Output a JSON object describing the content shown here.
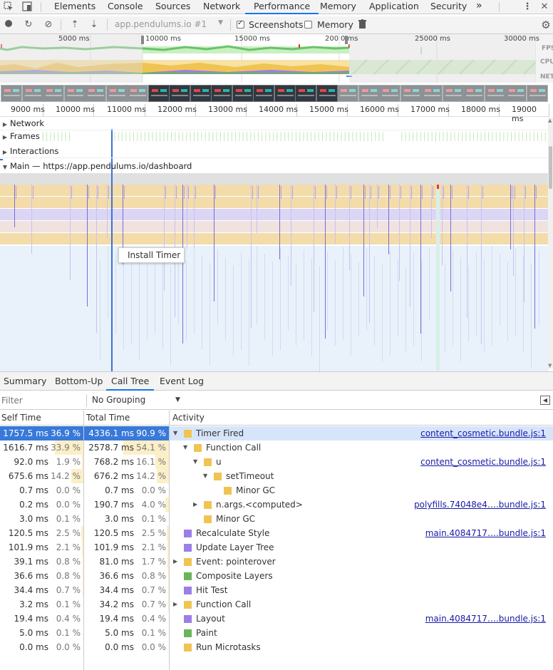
{
  "tabs": [
    "Elements",
    "Console",
    "Sources",
    "Network",
    "Performance",
    "Memory",
    "Application",
    "Security"
  ],
  "more_tabs_glyph": "»",
  "icons": {
    "inspect": "inspect-icon",
    "device": "device-toggle-icon",
    "menu": "kebab-menu-icon",
    "close": "close-icon"
  },
  "toolbar": {
    "recording_target": "app.pendulums.io #1",
    "screenshots_label": "Screenshots",
    "screenshots_checked": true,
    "memory_label": "Memory",
    "memory_checked": false
  },
  "overview": {
    "ticks": [
      "5000 ms",
      "10000 ms",
      "15000 ms",
      "200",
      "0 ms",
      "25000 ms",
      "30000 ms"
    ],
    "lane_labels": [
      "FPS",
      "CPU",
      "NET"
    ]
  },
  "ruler_ticks": [
    "9000 ms",
    "10000 ms",
    "11000 ms",
    "12000 ms",
    "13000 ms",
    "14000 ms",
    "15000 ms",
    "16000 ms",
    "17000 ms",
    "18000 ms",
    "19000 ms"
  ],
  "tracks": {
    "network": "Network",
    "frames": "Frames",
    "interactions": "Interactions",
    "main": "Main — https://app.pendulums.io/dashboard"
  },
  "tooltip": "Install Timer",
  "bottom_tabs": [
    "Summary",
    "Bottom-Up",
    "Call Tree",
    "Event Log"
  ],
  "active_bottom_tab": "Call Tree",
  "filter_placeholder": "Filter",
  "grouping": "No Grouping",
  "columns": {
    "self": "Self Time",
    "total": "Total Time",
    "activity": "Activity"
  },
  "colors": {
    "scripting": "#f0c452",
    "rendering": "#9b7fe6",
    "painting": "#6ab55a",
    "selection": "#3879d9",
    "accent": "#1a73e8"
  },
  "rows": [
    {
      "self": "1757.5 ms",
      "self_pct": "36.9 %",
      "total": "4336.1 ms",
      "total_pct": "90.9 %",
      "name": "Timer Fired",
      "cat": "scripting",
      "indent": 0,
      "expander": "open",
      "link": "content_cosmetic.bundle.js:1",
      "selected": true
    },
    {
      "self": "1616.7 ms",
      "self_pct": "33.9 %",
      "total": "2578.7 ms",
      "total_pct": "54.1 %",
      "name": "Function Call",
      "cat": "scripting",
      "indent": 1,
      "expander": "open",
      "link": ""
    },
    {
      "self": "92.0 ms",
      "self_pct": "1.9 %",
      "total": "768.2 ms",
      "total_pct": "16.1 %",
      "name": "u",
      "cat": "scripting",
      "indent": 2,
      "expander": "open",
      "link": "content_cosmetic.bundle.js:1"
    },
    {
      "self": "675.6 ms",
      "self_pct": "14.2 %",
      "total": "676.2 ms",
      "total_pct": "14.2 %",
      "name": "setTimeout",
      "cat": "scripting",
      "indent": 3,
      "expander": "open",
      "link": ""
    },
    {
      "self": "0.7 ms",
      "self_pct": "0.0 %",
      "total": "0.7 ms",
      "total_pct": "0.0 %",
      "name": "Minor GC",
      "cat": "scripting",
      "indent": 4,
      "expander": "",
      "link": ""
    },
    {
      "self": "0.2 ms",
      "self_pct": "0.0 %",
      "total": "190.7 ms",
      "total_pct": "4.0 %",
      "name": "n.args.<computed>",
      "cat": "scripting",
      "indent": 2,
      "expander": "closed",
      "link": "polyfills.74048e4….bundle.js:1"
    },
    {
      "self": "3.0 ms",
      "self_pct": "0.1 %",
      "total": "3.0 ms",
      "total_pct": "0.1 %",
      "name": "Minor GC",
      "cat": "scripting",
      "indent": 2,
      "expander": "",
      "link": ""
    },
    {
      "self": "120.5 ms",
      "self_pct": "2.5 %",
      "total": "120.5 ms",
      "total_pct": "2.5 %",
      "name": "Recalculate Style",
      "cat": "rendering",
      "indent": 0,
      "expander": "",
      "link": "main.4084717….bundle.js:1"
    },
    {
      "self": "101.9 ms",
      "self_pct": "2.1 %",
      "total": "101.9 ms",
      "total_pct": "2.1 %",
      "name": "Update Layer Tree",
      "cat": "rendering",
      "indent": 0,
      "expander": "",
      "link": ""
    },
    {
      "self": "39.1 ms",
      "self_pct": "0.8 %",
      "total": "81.0 ms",
      "total_pct": "1.7 %",
      "name": "Event: pointerover",
      "cat": "scripting",
      "indent": 0,
      "expander": "closed",
      "link": ""
    },
    {
      "self": "36.6 ms",
      "self_pct": "0.8 %",
      "total": "36.6 ms",
      "total_pct": "0.8 %",
      "name": "Composite Layers",
      "cat": "painting",
      "indent": 0,
      "expander": "",
      "link": ""
    },
    {
      "self": "34.4 ms",
      "self_pct": "0.7 %",
      "total": "34.4 ms",
      "total_pct": "0.7 %",
      "name": "Hit Test",
      "cat": "rendering",
      "indent": 0,
      "expander": "",
      "link": ""
    },
    {
      "self": "3.2 ms",
      "self_pct": "0.1 %",
      "total": "34.2 ms",
      "total_pct": "0.7 %",
      "name": "Function Call",
      "cat": "scripting",
      "indent": 0,
      "expander": "closed",
      "link": ""
    },
    {
      "self": "19.4 ms",
      "self_pct": "0.4 %",
      "total": "19.4 ms",
      "total_pct": "0.4 %",
      "name": "Layout",
      "cat": "rendering",
      "indent": 0,
      "expander": "",
      "link": "main.4084717….bundle.js:1"
    },
    {
      "self": "5.0 ms",
      "self_pct": "0.1 %",
      "total": "5.0 ms",
      "total_pct": "0.1 %",
      "name": "Paint",
      "cat": "painting",
      "indent": 0,
      "expander": "",
      "link": ""
    },
    {
      "self": "0.0 ms",
      "self_pct": "0.0 %",
      "total": "0.0 ms",
      "total_pct": "0.0 %",
      "name": "Run Microtasks",
      "cat": "scripting",
      "indent": 0,
      "expander": "",
      "link": ""
    }
  ]
}
